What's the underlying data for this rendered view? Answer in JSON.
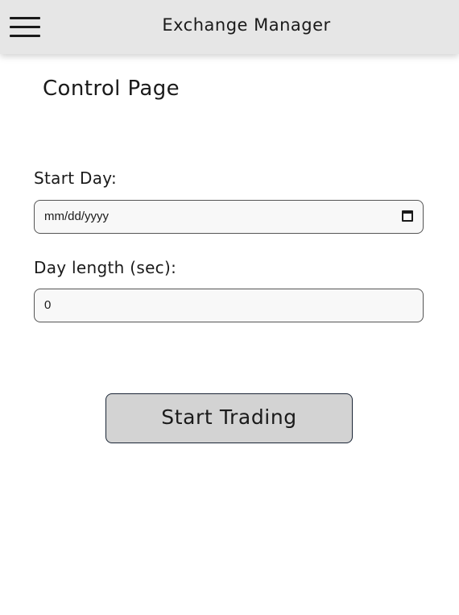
{
  "header": {
    "menu_icon": "hamburger-menu-icon",
    "title": "Exchange Manager"
  },
  "page": {
    "title": "Control Page"
  },
  "form": {
    "start_day": {
      "label": "Start Day:",
      "placeholder": "mm/dd/yyyy",
      "value": "",
      "icon": "calendar-icon"
    },
    "day_length": {
      "label": "Day length (sec):",
      "value": "0"
    },
    "submit_label": "Start Trading"
  },
  "colors": {
    "header_bg": "#e6e6e6",
    "button_bg": "#d3d3d3",
    "field_bg": "#f8f8f8"
  }
}
